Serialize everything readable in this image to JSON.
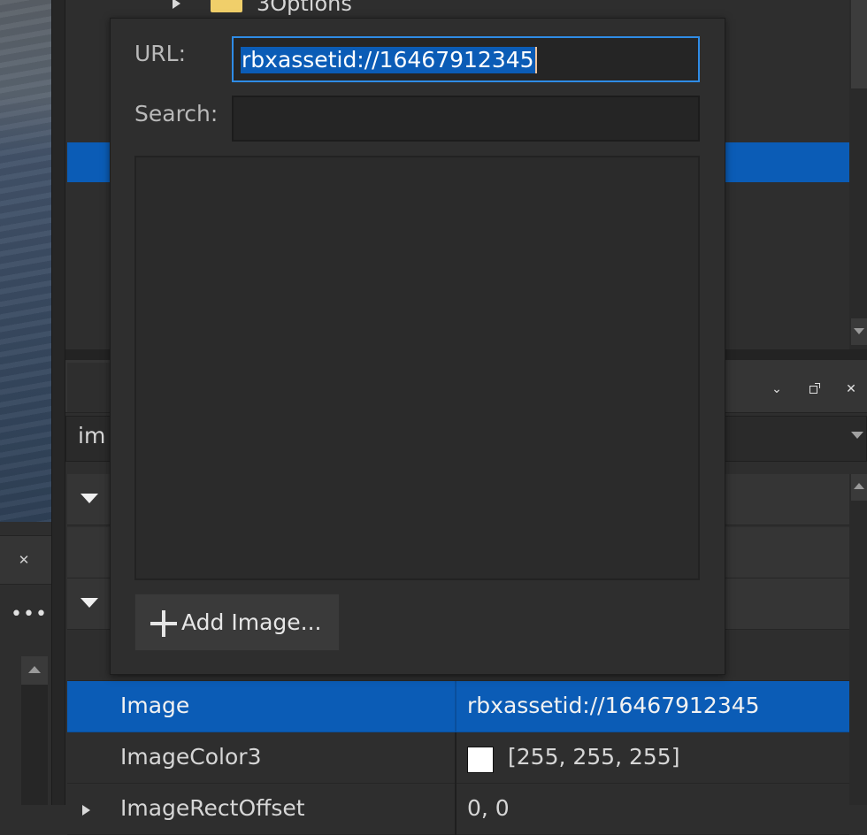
{
  "explorer": {
    "tree_item_label": "3Options"
  },
  "properties": {
    "filter_text": "im",
    "rows": [
      {
        "name": "Image",
        "value": "rbxassetid://16467912345",
        "selected": true
      },
      {
        "name": "ImageColor3",
        "value": "[255, 255, 255]",
        "swatch_color": "#ffffff"
      },
      {
        "name": "ImageRectOffset",
        "value": "0, 0"
      }
    ]
  },
  "asset_picker": {
    "url_label": "URL:",
    "url_value": "rbxassetid://16467912345",
    "search_label": "Search:",
    "search_value": "",
    "add_image_label": "Add Image..."
  },
  "colors": {
    "selection_blue": "#0b5cb6",
    "focus_border": "#2f8ce6",
    "panel_bg": "#2e2e2e"
  },
  "icons": [
    "chevron-down-icon",
    "float-window-icon",
    "close-icon",
    "more-icon",
    "plus-icon",
    "folder-icon",
    "expand-arrow-icon"
  ]
}
